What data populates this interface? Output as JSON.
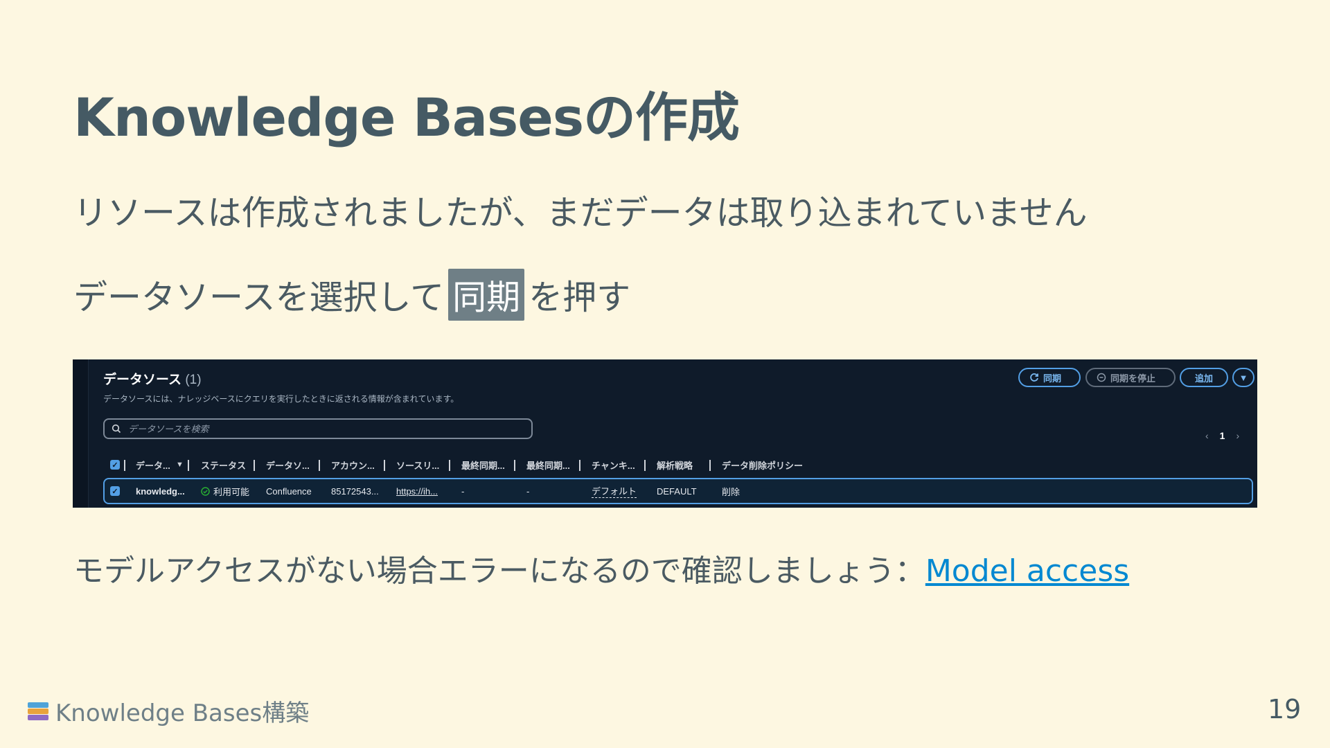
{
  "slide": {
    "title": "Knowledge Basesの作成",
    "line1": "リソースは作成されましたが、まだデータは取り込まれていません",
    "line2_before": "データソースを選択して",
    "line2_chip": "同期",
    "line2_after": "を押す",
    "line3_text": "モデルアクセスがない場合エラーになるので確認しましょう：",
    "line3_link": "Model access",
    "footer_text": "Knowledge Bases構築",
    "footer_icon": "books-icon",
    "page_number": "19"
  },
  "console": {
    "title": "データソース",
    "count": "(1)",
    "description": "データソースには、ナレッジベースにクエリを実行したときに返される情報が含まれています。",
    "buttons": {
      "sync": "同期",
      "stop_sync": "同期を停止",
      "add": "追加"
    },
    "search_placeholder": "データソースを検索",
    "pagination": {
      "current": "1"
    },
    "columns": [
      "データ...",
      "ステータス",
      "データソ...",
      "アカウン...",
      "ソースリ...",
      "最終同期...",
      "最終同期...",
      "チャンキ...",
      "解析戦略",
      "データ削除ポリシー"
    ],
    "row": {
      "name": "knowledg...",
      "status": "利用可能",
      "type": "Confluence",
      "account": "85172543...",
      "source_url": "https://ih...",
      "last_sync_1": "-",
      "last_sync_2": "-",
      "chunking": "デフォルト",
      "parsing": "DEFAULT",
      "deletion_policy": "削除"
    }
  },
  "colors": {
    "background": "#fdf7e1",
    "text": "#455a64",
    "chip": "#6f7f86",
    "link": "#0288d1",
    "console_bg": "#0f1b2a",
    "accent_blue": "#539fe5",
    "status_green": "#29ad32"
  }
}
